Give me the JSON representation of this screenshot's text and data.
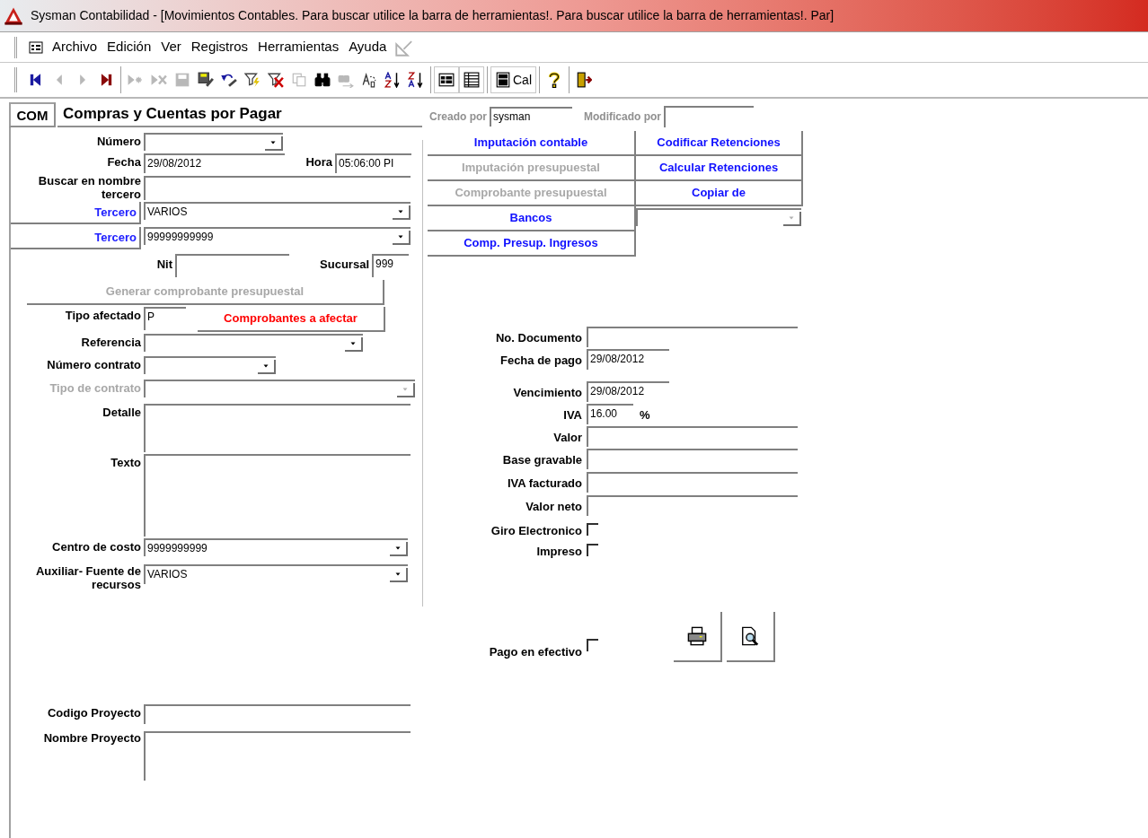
{
  "window": {
    "title": "Sysman Contabilidad - [Movimientos Contables. Para buscar utilice la barra de herramientas!. Para buscar utilice la barra de herramientas!. Par]"
  },
  "menu": [
    "Archivo",
    "Edición",
    "Ver",
    "Registros",
    "Herramientas",
    "Ayuda"
  ],
  "toolbar": [
    [
      {
        "disabled": false
      },
      {
        "disabled": true
      },
      {
        "disabled": true
      },
      {
        "disabled": false
      }
    ],
    [
      {
        "disabled": true
      },
      {
        "disabled": true
      },
      {
        "disabled": true
      },
      {
        "disabled": false
      },
      {
        "disabled": false
      },
      {
        "disabled": false
      },
      {
        "disabled": false
      },
      {
        "disabled": true
      },
      {
        "disabled": false
      },
      {
        "disabled": true
      },
      {
        "disabled": false
      },
      {
        "disabled": false
      },
      {
        "disabled": false
      }
    ],
    [
      {
        "disabled": false
      },
      {
        "disabled": false
      }
    ],
    [
      {
        "disabled": false,
        "label": "Cal"
      }
    ],
    [
      {
        "disabled": false
      }
    ],
    [
      {
        "disabled": false
      }
    ]
  ],
  "form": {
    "code": "COM",
    "title": "Compras y Cuentas por Pagar",
    "created_by": {
      "label": "Creado por",
      "value": "sysman"
    },
    "modified_by": {
      "label": "Modificado por"
    }
  },
  "left_fields": [
    {
      "kind": "combo",
      "label": "Número",
      "disabled": false
    },
    {
      "kind": "text",
      "label": "Fecha",
      "value": "29/08/2012",
      "disabled": false,
      "extra": {
        "label": "Hora",
        "value": "05:06:00 PI"
      }
    },
    {
      "kind": "text",
      "label": "Buscar en nombre tercero",
      "disabled": false
    },
    {
      "kind": "combo",
      "label": "Tercero",
      "label_button": true,
      "value": "VARIOS",
      "disabled": false
    },
    {
      "kind": "combo",
      "label": "Tercero",
      "label_button": true,
      "value": "99999999999",
      "disabled": false
    },
    {
      "kind": "pair",
      "label": "Nit",
      "disabled": false,
      "extra": {
        "label": "Sucursal",
        "value": "999"
      }
    },
    {
      "kind": "button",
      "label": "Generar comprobante presupuestal",
      "disabled": true
    },
    {
      "kind": "text",
      "label": "Tipo afectado",
      "value": "P",
      "disabled": false,
      "button": "Comprobantes a afectar"
    },
    {
      "kind": "combo",
      "label": "Referencia",
      "disabled": false
    },
    {
      "kind": "combo",
      "label": "Número contrato",
      "disabled": false
    },
    {
      "kind": "combo",
      "label": "Tipo de contrato",
      "disabled": true
    },
    {
      "kind": "memo",
      "label": "Detalle",
      "disabled": false
    },
    {
      "kind": "memo",
      "label": "Texto",
      "disabled": false
    },
    {
      "kind": "combo",
      "label": "Centro de costo",
      "value": "9999999999",
      "disabled": false
    },
    {
      "kind": "combo",
      "label": "Auxiliar- Fuente de recursos",
      "value": "VARIOS",
      "disabled": false
    },
    {
      "kind": "text",
      "label": "Codigo Proyecto",
      "disabled": false
    },
    {
      "kind": "memo",
      "label": "Nombre Proyecto",
      "disabled": false
    }
  ],
  "action_buttons": [
    {
      "kind": "button",
      "label": "Imputación contable",
      "disabled": false
    },
    {
      "kind": "button",
      "label": "Codificar Retenciones",
      "disabled": false
    },
    {
      "kind": "button",
      "label": "Imputación presupuestal",
      "disabled": true
    },
    {
      "kind": "button",
      "label": "Calcular Retenciones",
      "disabled": false
    },
    {
      "kind": "button",
      "label": "Comprobante presupuestal",
      "disabled": true
    },
    {
      "kind": "button",
      "label": "Copiar de",
      "disabled": false
    },
    {
      "kind": "button",
      "label": "Bancos",
      "disabled": false
    },
    {
      "kind": "combo",
      "disabled": true
    },
    {
      "kind": "button",
      "label": "Comp. Presup. Ingresos",
      "disabled": false
    }
  ],
  "right_fields": [
    {
      "kind": "text",
      "label": "No. Documento"
    },
    {
      "kind": "text",
      "label": "Fecha de pago",
      "value": "29/08/2012"
    },
    {
      "kind": "text",
      "label": "Vencimiento",
      "value": "29/08/2012"
    },
    {
      "kind": "text",
      "label": "IVA",
      "value": "16.00",
      "suffix": "%"
    },
    {
      "kind": "text",
      "label": "Valor"
    },
    {
      "kind": "text",
      "label": "Base gravable"
    },
    {
      "kind": "text",
      "label": "IVA facturado"
    },
    {
      "kind": "text",
      "label": "Valor neto"
    },
    {
      "kind": "check",
      "label": "Giro Electronico",
      "checked": false
    },
    {
      "kind": "check",
      "label": "Impreso",
      "checked": false
    }
  ],
  "cash_payment": {
    "label": "Pago en efectivo",
    "checked": false
  }
}
